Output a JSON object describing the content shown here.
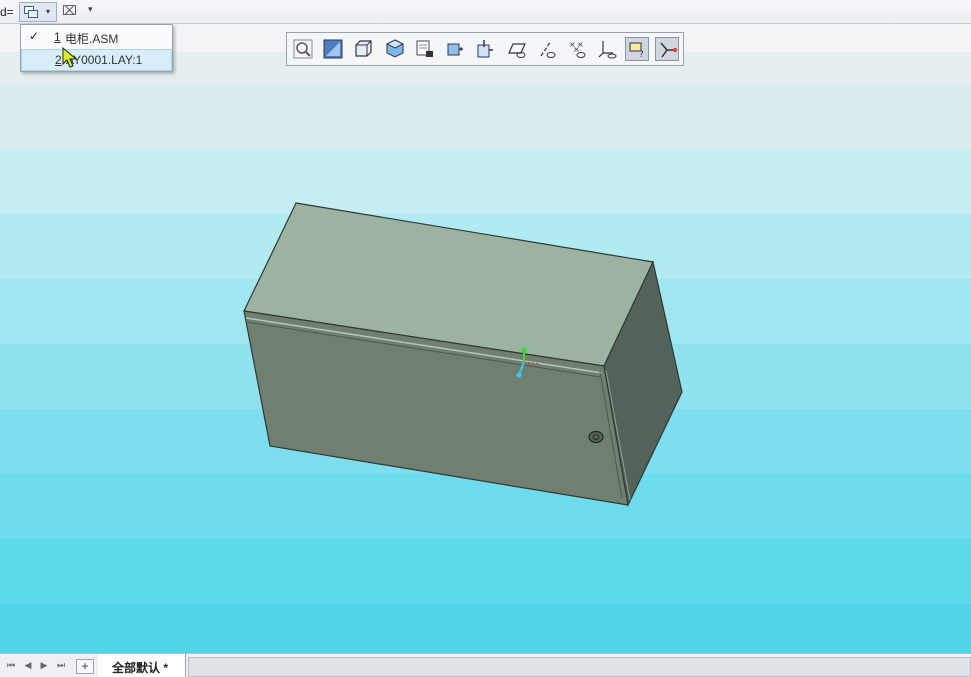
{
  "topbar": {
    "cut_label": "d=",
    "window_menu_icon": "window-list-icon",
    "dropdown_arrow": "▾",
    "close_icon_glyph": "⌧",
    "more_icon_glyph": "▾"
  },
  "window_menu": {
    "items": [
      {
        "number": "1",
        "label": "电柜.ASM",
        "checked": true,
        "check_glyph": "✓"
      },
      {
        "number": "2",
        "label": "AY0001.LAY:1",
        "checked": false,
        "hovered": true
      }
    ]
  },
  "view_toolbar": {
    "buttons": [
      {
        "name": "refit-icon"
      },
      {
        "name": "zoom-area-icon"
      },
      {
        "name": "display-style-icon"
      },
      {
        "name": "named-views-icon"
      },
      {
        "name": "saved-orientations-icon"
      },
      {
        "name": "view-manager-icon"
      },
      {
        "name": "spin-center-icon"
      },
      {
        "name": "datum-plane-display-icon"
      },
      {
        "name": "datum-axis-display-icon"
      },
      {
        "name": "datum-point-display-icon"
      },
      {
        "name": "coordinate-system-display-icon"
      },
      {
        "name": "annotation-display-icon",
        "active": true
      },
      {
        "name": "spin-center-toggle-icon",
        "active": true
      }
    ]
  },
  "bottom_bar": {
    "nav": [
      "⏮",
      "◀",
      "▶",
      "⏭"
    ],
    "add_label": "+",
    "active_tab": "全部默认 *"
  },
  "colors": {
    "model_front": "#6f7f70",
    "model_top": "#9bb3a0",
    "model_side": "#54635a",
    "background_top": "#f2f4f6",
    "background_bottom": "#4fd4e8"
  }
}
